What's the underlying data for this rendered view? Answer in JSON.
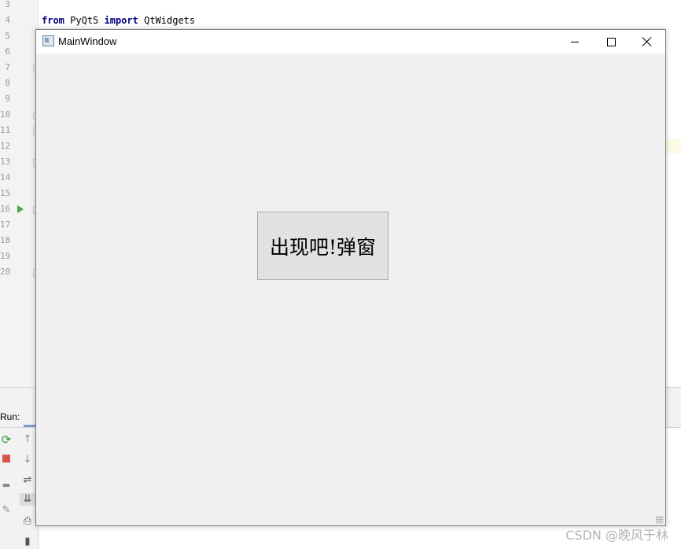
{
  "ide": {
    "line_numbers": [
      "3",
      "4",
      "5",
      "6",
      "7",
      "8",
      "9",
      "10",
      "11",
      "12",
      "13",
      "14",
      "15",
      "16",
      "17",
      "18",
      "19",
      "20"
    ],
    "code": {
      "keyword_from": "from",
      "module": "PyQt5",
      "keyword_import": "import",
      "name": "QtWidgets"
    },
    "run_panel": {
      "label": "Run:"
    }
  },
  "window": {
    "title": "MainWindow",
    "icon": "window-app-icon",
    "controls": {
      "minimize": "minimize-icon",
      "maximize": "maximize-icon",
      "close": "close-icon"
    },
    "button_label": "出现吧!弹窗"
  },
  "watermark": "CSDN @晚风于林",
  "colors": {
    "window_bg": "#f0f0f0",
    "button_bg": "#e1e1e1",
    "run_arrow": "#4ca14c",
    "stop": "#d9534f",
    "keyword": "#000080"
  }
}
